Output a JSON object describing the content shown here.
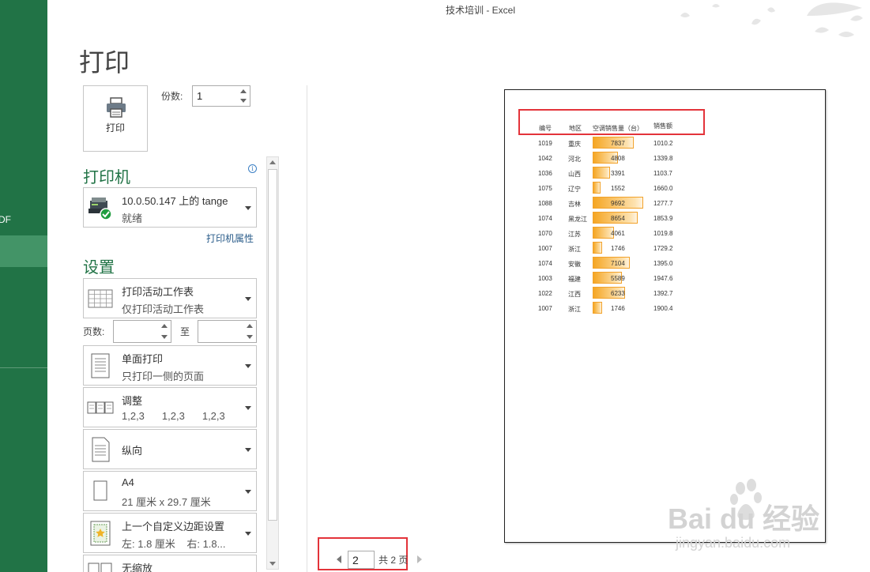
{
  "window": {
    "title": "技术培训 - Excel"
  },
  "backstage": {
    "pdf_item": "DF"
  },
  "page": {
    "title": "打印"
  },
  "print_button": {
    "label": "打印"
  },
  "copies": {
    "label": "份数:",
    "value": "1"
  },
  "printer": {
    "heading": "打印机",
    "name": "10.0.50.147 上的 tange",
    "status": "就绪",
    "properties_link": "打印机属性"
  },
  "settings": {
    "heading": "设置",
    "scope": {
      "title": "打印活动工作表",
      "desc": "仅打印活动工作表"
    },
    "pages": {
      "label": "页数:",
      "to": "至",
      "from_value": "",
      "to_value": ""
    },
    "sides": {
      "title": "单面打印",
      "desc": "只打印一侧的页面"
    },
    "collate": {
      "title": "调整",
      "desc": [
        "1,2,3",
        "1,2,3",
        "1,2,3"
      ]
    },
    "orientation": {
      "title": "纵向"
    },
    "paper": {
      "title": "A4",
      "desc": "21 厘米 x 29.7 厘米"
    },
    "margins": {
      "title": "上一个自定义边距设置",
      "desc": "左: 1.8 厘米    右: 1.8..."
    },
    "scaling": {
      "title": "无缩放"
    }
  },
  "preview": {
    "headers": [
      "编号",
      "地区",
      "空调销售量（台）",
      "销售额"
    ],
    "rows": [
      {
        "id": "1019",
        "region": "重庆",
        "qty": 7837,
        "sales": "1010.2"
      },
      {
        "id": "1042",
        "region": "河北",
        "qty": 4808,
        "sales": "1339.8"
      },
      {
        "id": "1036",
        "region": "山西",
        "qty": 3391,
        "sales": "1103.7"
      },
      {
        "id": "1075",
        "region": "辽宁",
        "qty": 1552,
        "sales": "1660.0"
      },
      {
        "id": "1088",
        "region": "吉林",
        "qty": 9692,
        "sales": "1277.7"
      },
      {
        "id": "1074",
        "region": "黑龙江",
        "qty": 8654,
        "sales": "1853.9"
      },
      {
        "id": "1070",
        "region": "江苏",
        "qty": 4061,
        "sales": "1019.8"
      },
      {
        "id": "1007",
        "region": "浙江",
        "qty": 1746,
        "sales": "1729.2"
      },
      {
        "id": "1074",
        "region": "安徽",
        "qty": 7104,
        "sales": "1395.0"
      },
      {
        "id": "1003",
        "region": "福建",
        "qty": 5589,
        "sales": "1947.6"
      },
      {
        "id": "1022",
        "region": "江西",
        "qty": 6233,
        "sales": "1392.7"
      },
      {
        "id": "1007",
        "region": "浙江",
        "qty": 1746,
        "sales": "1900.4"
      }
    ],
    "bar_max": 9692,
    "bar_color": "#f5a623"
  },
  "pager": {
    "current": "2",
    "total_label": "共 2 页"
  },
  "watermark": {
    "brand": "Bai du 经验",
    "url": "jingyan.baidu.com"
  },
  "colors": {
    "accent": "#217346",
    "highlight": "#e3333a"
  }
}
